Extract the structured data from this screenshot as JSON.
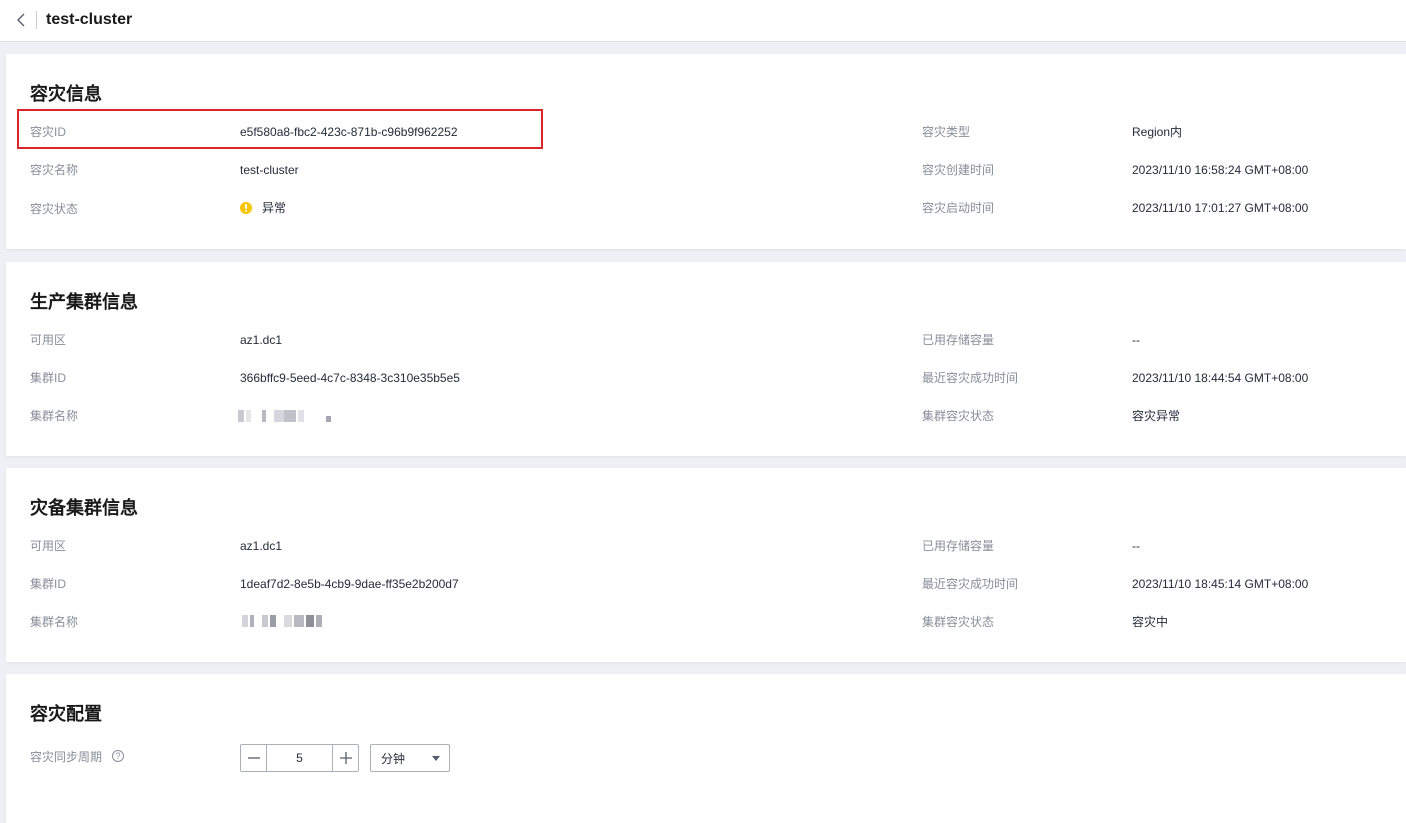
{
  "header": {
    "title": "test-cluster",
    "back_icon": "chevron-left-icon"
  },
  "dr_info": {
    "title": "容灾信息",
    "left": [
      {
        "label": "容灾ID",
        "value": "e5f580a8-fbc2-423c-871b-c96b9f962252"
      },
      {
        "label": "容灾名称",
        "value": "test-cluster"
      },
      {
        "label": "容灾状态",
        "value": "异常",
        "status_color": "#f8c500",
        "status_icon": "warning-icon"
      }
    ],
    "right": [
      {
        "label": "容灾类型",
        "value": "Region内"
      },
      {
        "label": "容灾创建时间",
        "value": "2023/11/10 16:58:24 GMT+08:00"
      },
      {
        "label": "容灾启动时间",
        "value": "2023/11/10 17:01:27 GMT+08:00"
      }
    ],
    "highlight_color": "#d9262c"
  },
  "prod_cluster": {
    "title": "生产集群信息",
    "left": [
      {
        "label": "可用区",
        "value": "az1.dc1"
      },
      {
        "label": "集群ID",
        "value": "366bffc9-5eed-4c7c-8348-3c310e35b5e5"
      },
      {
        "label": "集群名称",
        "value": ""
      }
    ],
    "right": [
      {
        "label": "已用存储容量",
        "value": "--"
      },
      {
        "label": "最近容灾成功时间",
        "value": "2023/11/10 18:44:54 GMT+08:00"
      },
      {
        "label": "集群容灾状态",
        "value": "容灾异常"
      }
    ]
  },
  "dr_cluster": {
    "title": "灾备集群信息",
    "left": [
      {
        "label": "可用区",
        "value": "az1.dc1"
      },
      {
        "label": "集群ID",
        "value": "1deaf7d2-8e5b-4cb9-9dae-ff35e2b200d7"
      },
      {
        "label": "集群名称",
        "value": ""
      }
    ],
    "right": [
      {
        "label": "已用存储容量",
        "value": "--"
      },
      {
        "label": "最近容灾成功时间",
        "value": "2023/11/10 18:45:14 GMT+08:00"
      },
      {
        "label": "集群容灾状态",
        "value": "容灾中"
      }
    ]
  },
  "dr_config": {
    "title": "容灾配置",
    "sync_label": "容灾同步周期",
    "help_icon": "question-circle-icon",
    "sync_value": "5",
    "unit_selected": "分钟"
  }
}
